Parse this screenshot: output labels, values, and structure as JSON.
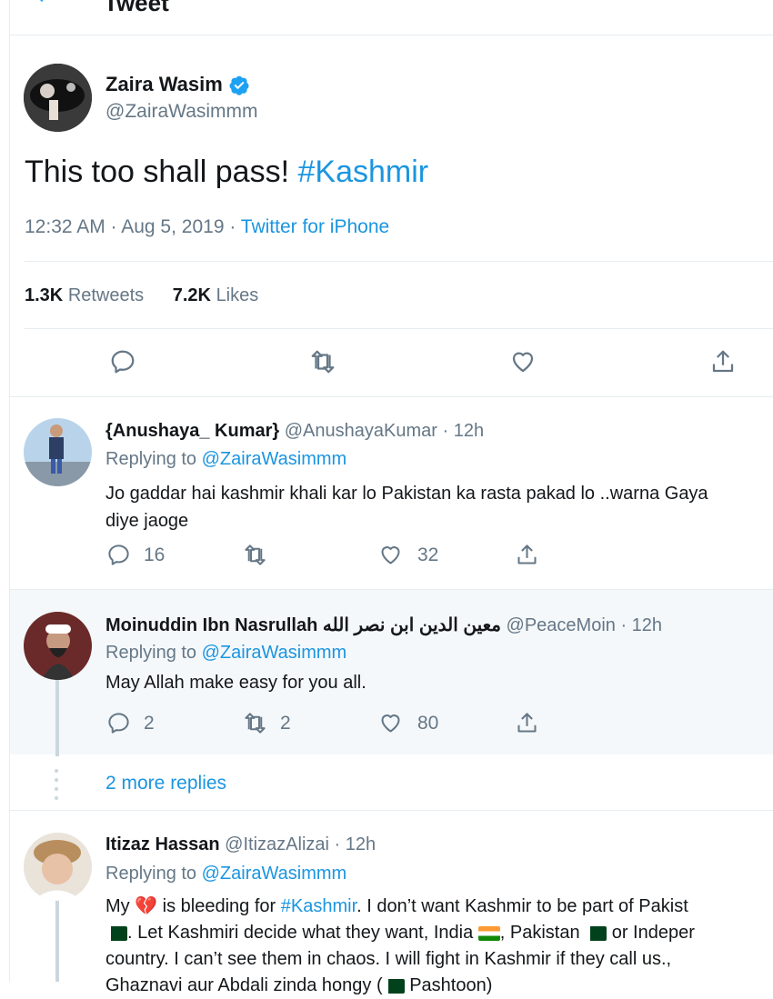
{
  "header": {
    "title": "Tweet"
  },
  "main_tweet": {
    "author_name": "Zaira Wasim",
    "author_handle": "@ZairaWasimmm",
    "text": "This too shall pass!",
    "hashtag": "#Kashmir",
    "timestamp": "12:32 AM · Aug 5, 2019 · ",
    "source": "Twitter for iPhone",
    "retweets_count": "1.3K",
    "retweets_label": "Retweets",
    "likes_count": "7.2K",
    "likes_label": "Likes"
  },
  "replies": [
    {
      "name": "{Anushaya_ Kumar}",
      "handle": "@AnushayaKumar",
      "time": "· 12h",
      "replying_label": "Replying to ",
      "replying_to": "@ZairaWasimmm",
      "text_line1": "Jo gaddar hai kashmir khali kar lo Pakistan ka rasta pakad lo ..warna Gaya",
      "text_line2": "diye jaoge",
      "reply_count": "16",
      "retweet_count": "",
      "like_count": "32"
    },
    {
      "name": "Moinuddin Ibn Nasrullah معین الدین ابن نصر الله",
      "handle": "@PeaceMoin",
      "time": "· 12h",
      "replying_label": "Replying to ",
      "replying_to": "@ZairaWasimmm",
      "text_line1": "May Allah make easy for you all.",
      "reply_count": "2",
      "retweet_count": "2",
      "like_count": "80"
    },
    {
      "name": "Itizaz Hassan",
      "handle": "@ItizazAlizai",
      "time": "· 12h",
      "replying_label": "Replying to ",
      "replying_to": "@ZairaWasimmm",
      "line1_a": "My ",
      "line1_b": " is bleeding for ",
      "line1_hashtag": "#Kashmir",
      "line1_c": ". I don’t want Kashmir to be part of Pakist",
      "line2_a": ". Let Kashmiri decide what they want, India ",
      "line2_b": ", Pakistan ",
      "line2_c": " or Indeper",
      "line3": "country. I can’t see them in chaos. I will fight in Kashmir if they call us.,",
      "line4_a": "Ghaznavi aur Abdali zinda hongy (",
      "line4_b": " Pashtoon)"
    }
  ],
  "more_replies": "2 more replies",
  "icons": {
    "back": "back-arrow-icon",
    "verified": "verified-badge-icon",
    "reply": "reply-icon",
    "retweet": "retweet-icon",
    "like": "heart-icon",
    "share": "share-icon"
  },
  "colors": {
    "accent": "#1da1f2",
    "link": "#1b95e0",
    "muted": "#657786",
    "divider": "#e6ecf0",
    "highlight_bg": "#f5f8fa"
  }
}
